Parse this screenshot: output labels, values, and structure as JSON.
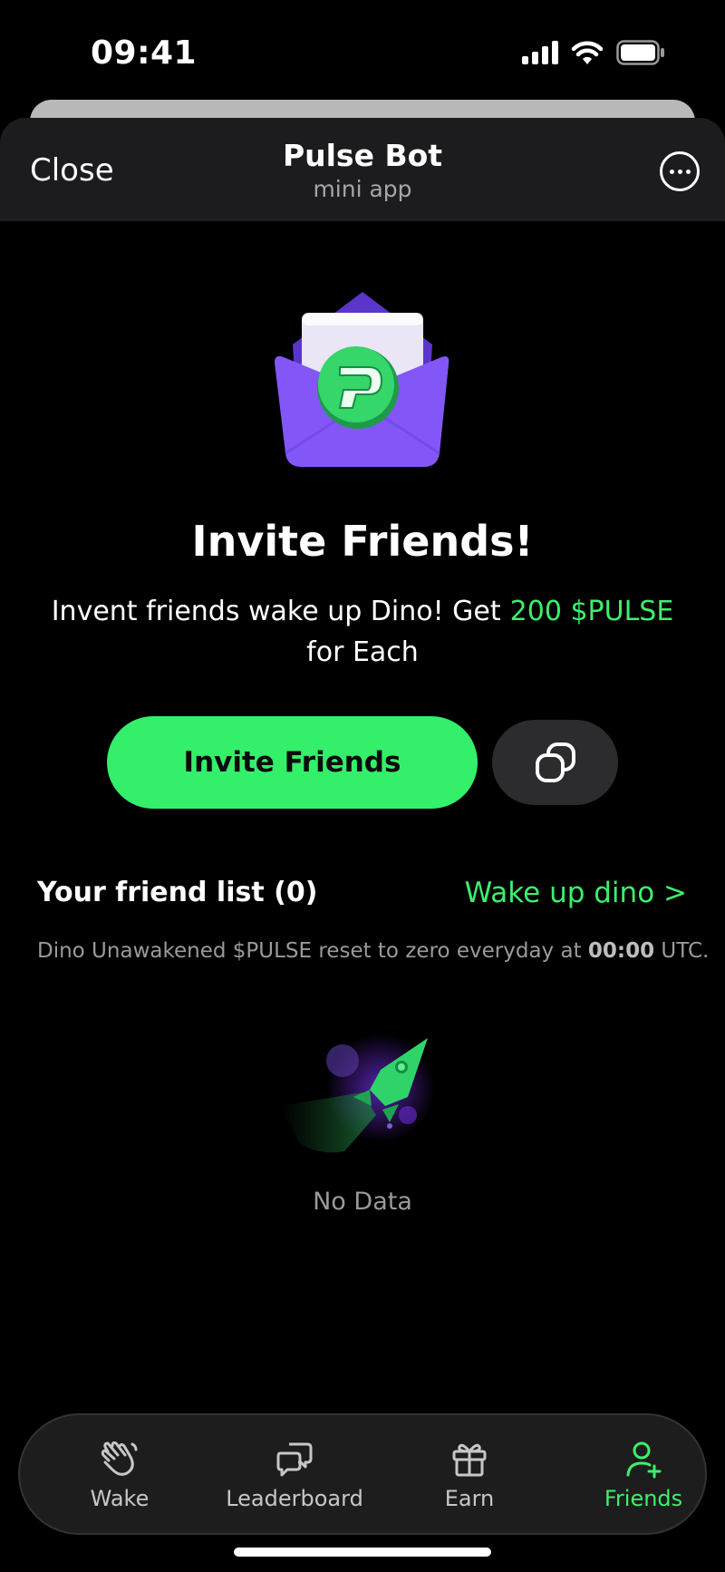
{
  "status_bar": {
    "time": "09:41"
  },
  "header": {
    "close_label": "Close",
    "title": "Pulse Bot",
    "subtitle": "mini app"
  },
  "hero": {
    "title": "Invite Friends!",
    "desc_prefix": "Invent friends wake up Dino! Get",
    "reward": "200 $PULSE",
    "desc_suffix": "for Each"
  },
  "actions": {
    "invite_label": "Invite Friends"
  },
  "friends": {
    "list_title": "Your friend list (0)",
    "wake_link": "Wake up dino >",
    "reset_prefix": "Dino Unawakened $PULSE reset to zero everyday at ",
    "reset_time": "00:00",
    "reset_suffix": " UTC.",
    "empty_text": "No Data"
  },
  "tabs": [
    {
      "label": "Wake",
      "icon": "hand-wave-icon"
    },
    {
      "label": "Leaderboard",
      "icon": "chat-bubbles-icon"
    },
    {
      "label": "Earn",
      "icon": "gift-icon"
    },
    {
      "label": "Friends",
      "icon": "add-user-icon"
    }
  ],
  "colors": {
    "accent": "#33ef6a",
    "background": "#000000",
    "header": "#1c1c1e",
    "tabbar": "#1d1d1d",
    "hero_purple": "#7b52f0"
  }
}
